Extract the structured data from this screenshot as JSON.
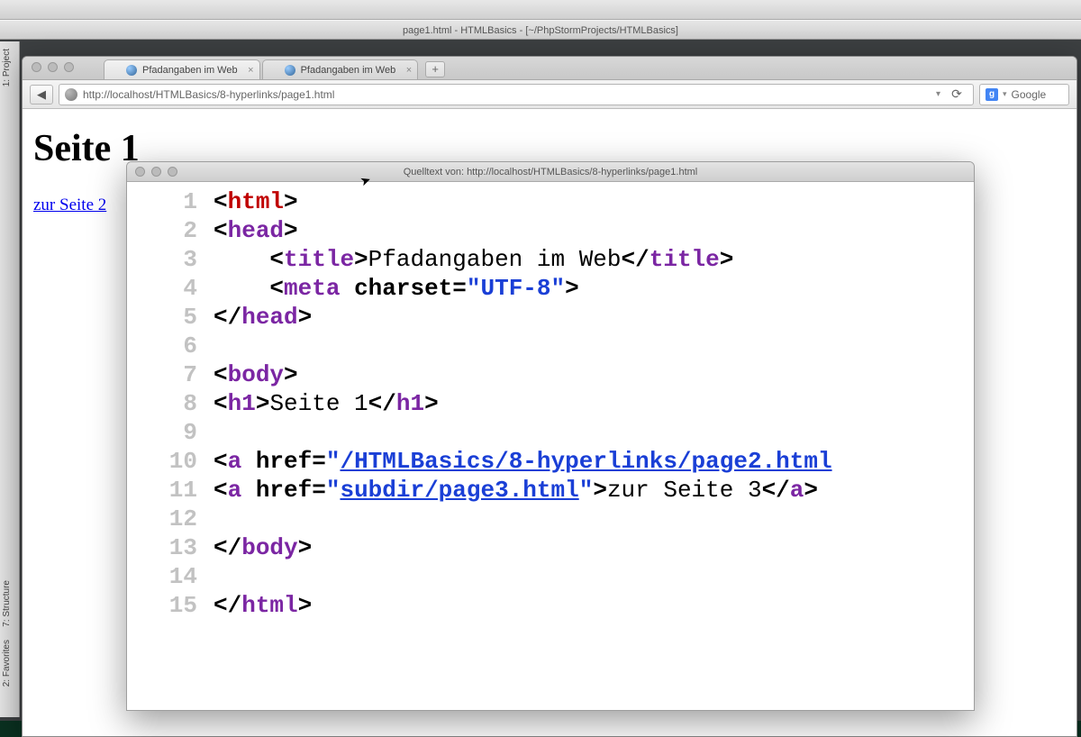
{
  "ide": {
    "title": "page1.html - HTMLBasics - [~/PhpStormProjects/HTMLBasics]",
    "left_tabs": [
      "1: Project",
      "7: Structure",
      "2: Favorites"
    ]
  },
  "browser": {
    "tabs": [
      {
        "label": "Pfadangaben im Web"
      },
      {
        "label": "Pfadangaben im Web"
      }
    ],
    "url": "http://localhost/HTMLBasics/8-hyperlinks/page1.html",
    "search_engine": "Google"
  },
  "page": {
    "h1": "Seite 1",
    "link_text": "zur Seite 2 "
  },
  "source": {
    "title": "Quelltext von: http://localhost/HTMLBasics/8-hyperlinks/page1.html",
    "lines": {
      "l3_title_text": "Pfadangaben im Web",
      "l4_charset": "UTF-8",
      "l8_text": "Seite 1",
      "l10_href": "/HTMLBasics/8-hyperlinks/page2.html",
      "l11_href": "subdir/page3.html",
      "l11_text": "zur Seite 3"
    }
  }
}
